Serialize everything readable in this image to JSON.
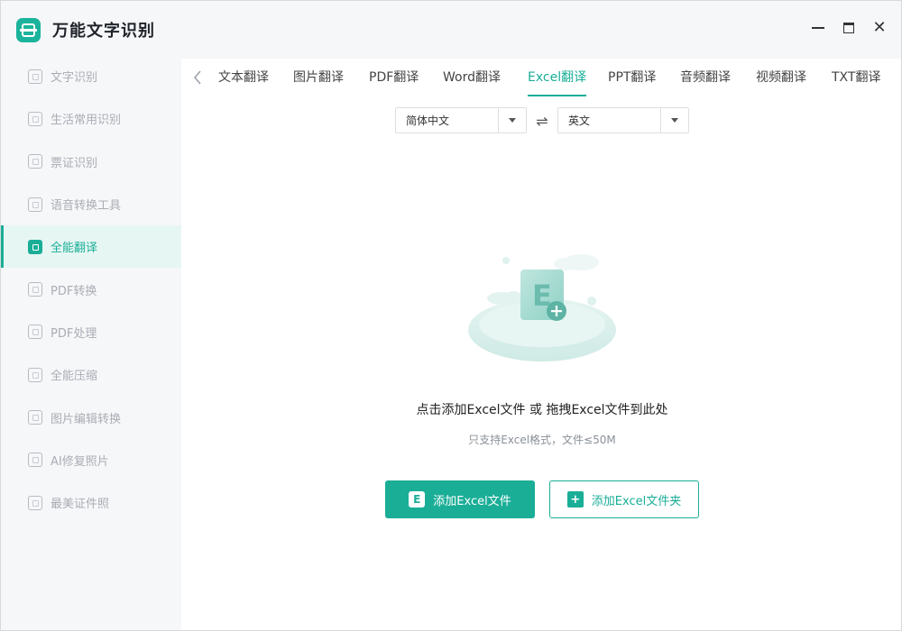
{
  "app": {
    "title": "万能文字识别"
  },
  "sidebar": {
    "items": [
      {
        "label": "文字识别",
        "icon": "scan-text-icon"
      },
      {
        "label": "生活常用识别",
        "icon": "scan-life-icon"
      },
      {
        "label": "票证识别",
        "icon": "scan-ticket-icon"
      },
      {
        "label": "语音转换工具",
        "icon": "voice-convert-icon"
      },
      {
        "label": "全能翻译",
        "icon": "translate-icon",
        "active": true
      },
      {
        "label": "PDF转换",
        "icon": "pdf-convert-icon"
      },
      {
        "label": "PDF处理",
        "icon": "pdf-process-icon"
      },
      {
        "label": "全能压缩",
        "icon": "compress-icon"
      },
      {
        "label": "图片编辑转换",
        "icon": "image-edit-icon"
      },
      {
        "label": "AI修复照片",
        "icon": "ai-repair-icon"
      },
      {
        "label": "最美证件照",
        "icon": "id-photo-icon"
      }
    ]
  },
  "tabs": {
    "items": [
      {
        "label": "文本翻译"
      },
      {
        "label": "图片翻译"
      },
      {
        "label": "PDF翻译"
      },
      {
        "label": "Word翻译"
      },
      {
        "label": "Excel翻译",
        "active": true
      },
      {
        "label": "PPT翻译"
      },
      {
        "label": "音频翻译"
      },
      {
        "label": "视频翻译"
      },
      {
        "label": "TXT翻译"
      }
    ]
  },
  "language": {
    "source": "简体中文",
    "target": "英文",
    "swap_icon": "⇌"
  },
  "upload": {
    "hint": "点击添加Excel文件 或 拖拽Excel文件到此处",
    "sub_hint": "只支持Excel格式，文件≤50M",
    "add_file_label": "添加Excel文件",
    "add_folder_label": "添加Excel文件夹",
    "illustration_letter": "E"
  },
  "colors": {
    "accent": "#1aae97",
    "sidebar_bg": "#f6f7f9",
    "active_bg": "#e6f6f3"
  }
}
